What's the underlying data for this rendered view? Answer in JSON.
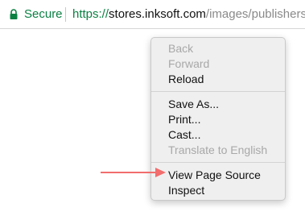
{
  "address_bar": {
    "secure_label": "Secure",
    "url_scheme": "https://",
    "url_host": "stores.inksoft.com",
    "url_path": "/images/publishers/"
  },
  "context_menu": {
    "group1": [
      "Back",
      "Forward",
      "Reload"
    ],
    "group2": [
      "Save As...",
      "Print...",
      "Cast...",
      "Translate to English"
    ],
    "group3": [
      "View Page Source",
      "Inspect"
    ],
    "disabled": [
      "Back",
      "Forward",
      "Translate to English"
    ]
  },
  "colors": {
    "secure_green": "#0b8043",
    "arrow": "#f26d6d",
    "menu_bg": "#efefef"
  }
}
